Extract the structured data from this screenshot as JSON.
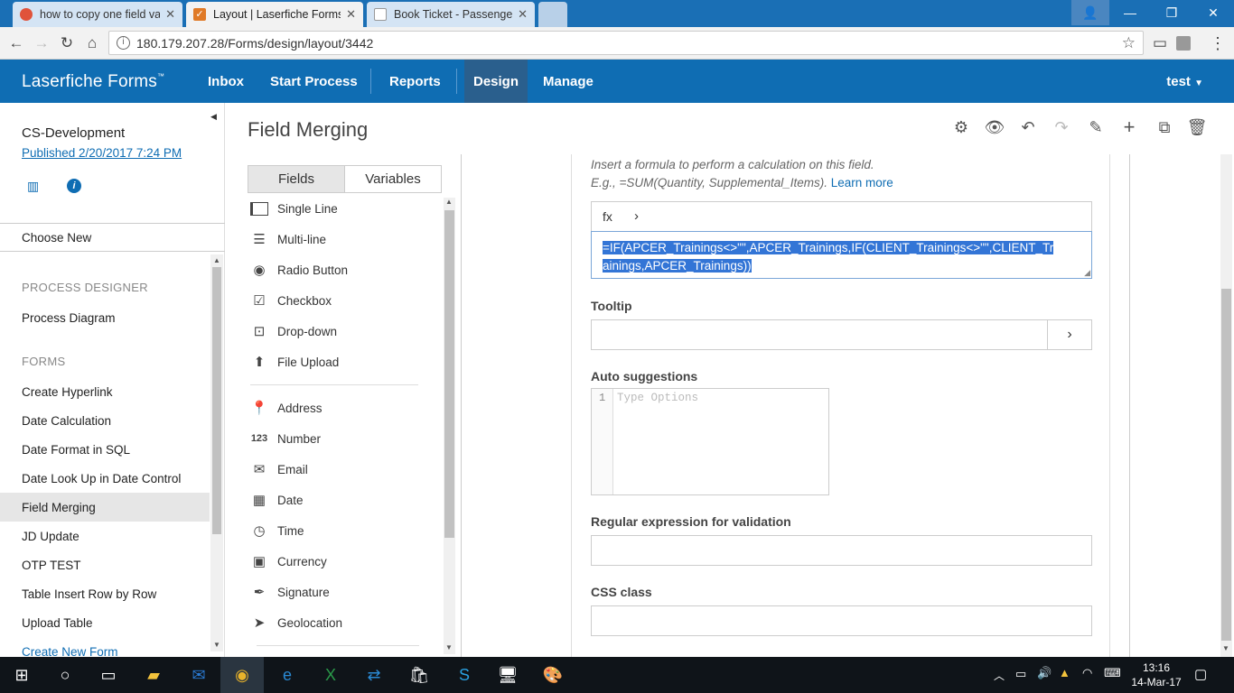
{
  "browser": {
    "tabs": [
      {
        "title": "how to copy one field va",
        "favicon_color": "#e0533b"
      },
      {
        "title": "Layout | Laserfiche Forms",
        "favicon_color": "#e07a27"
      },
      {
        "title": "Book Ticket - Passengers",
        "favicon_color": "#ffffff"
      }
    ],
    "url": "180.179.207.28/Forms/design/layout/3442"
  },
  "app": {
    "brand": "Laserfiche Forms",
    "brand_tm": "™",
    "nav": [
      "Inbox",
      "Start Process",
      "Reports",
      "Design",
      "Manage"
    ],
    "active_nav": "Design",
    "user": "test"
  },
  "sidebar": {
    "process_name": "CS-Development",
    "published": "Published 2/20/2017 7:24 PM",
    "choose_new": "Choose New",
    "section_process": "PROCESS DESIGNER",
    "process_diagram": "Process Diagram",
    "section_forms": "FORMS",
    "forms": [
      "Create Hyperlink",
      "Date Calculation",
      "Date Format in SQL",
      "Date Look Up in Date Control",
      "Field Merging",
      "JD Update",
      "OTP TEST",
      "Table Insert Row by Row",
      "Upload Table"
    ],
    "selected_form": "Field Merging",
    "create_new": "Create New Form"
  },
  "main": {
    "title": "Field Merging",
    "palette_tabs": [
      "Fields",
      "Variables"
    ],
    "fields_group1": [
      {
        "label": "Single Line",
        "icon": "single-line-icon"
      },
      {
        "label": "Multi-line",
        "icon": "multi-line-icon"
      },
      {
        "label": "Radio Button",
        "icon": "radio-icon"
      },
      {
        "label": "Checkbox",
        "icon": "checkbox-icon"
      },
      {
        "label": "Drop-down",
        "icon": "dropdown-icon"
      },
      {
        "label": "File Upload",
        "icon": "upload-icon"
      }
    ],
    "fields_group2": [
      {
        "label": "Address",
        "icon": "pin-icon"
      },
      {
        "label": "Number",
        "icon": "number-icon"
      },
      {
        "label": "Email",
        "icon": "email-icon"
      },
      {
        "label": "Date",
        "icon": "calendar-icon"
      },
      {
        "label": "Time",
        "icon": "clock-icon"
      },
      {
        "label": "Currency",
        "icon": "currency-icon"
      },
      {
        "label": "Signature",
        "icon": "pen-icon"
      },
      {
        "label": "Geolocation",
        "icon": "location-arrow-icon"
      }
    ]
  },
  "props": {
    "hint_line1": "Insert a formula to perform a calculation on this field.",
    "hint_line2": "E.g., =SUM(Quantity, Supplemental_Items).",
    "learn_more": "Learn more",
    "fx_label": "fx",
    "formula_line1": "=IF(APCER_Trainings<>\"\",APCER_Trainings,IF(CLIENT_Trainings<>\"\",CLIENT_Tr",
    "formula_line2": "ainings,APCER_Trainings))",
    "tooltip_label": "Tooltip",
    "auto_label": "Auto suggestions",
    "auto_line": "1",
    "auto_placeholder": "Type Options",
    "regex_label": "Regular expression for validation",
    "css_label": "CSS class"
  },
  "taskbar": {
    "time": "13:16",
    "date": "14-Mar-17"
  }
}
